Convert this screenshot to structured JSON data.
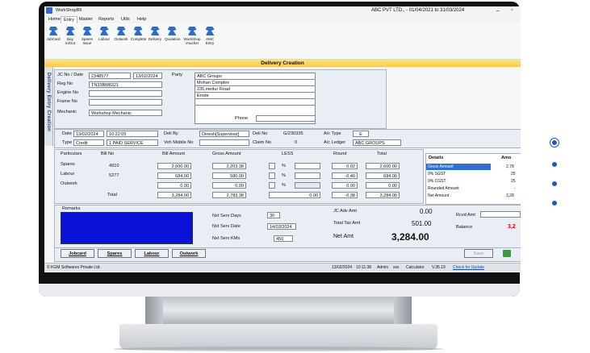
{
  "app": {
    "title": "WorkShopB9",
    "company": "ABC PVT LTD., - 01/04/2021 to 31/03/2024",
    "minimize": "–",
    "restore": "▫"
  },
  "menu": [
    "Home",
    "Entry",
    "Master",
    "Reports",
    "Utils",
    "Help"
  ],
  "ribbon": [
    {
      "label": "JobCard"
    },
    {
      "label": "Bay In/Out"
    },
    {
      "label": "Spares Issue"
    },
    {
      "label": "Labour"
    },
    {
      "label": "Outwork"
    },
    {
      "label": "Complete"
    },
    {
      "label": "Delivery"
    },
    {
      "label": "Quotation"
    },
    {
      "label": "WorkShop Voucher"
    },
    {
      "label": "AMC Entry"
    }
  ],
  "window_title": "Delivery Creation",
  "side_label": "Delivery Entry Creation",
  "jc": {
    "jc_no_label": "JC No / Date",
    "jc_no": "2348577",
    "jc_date": "13/02/2024",
    "reg_label": "Reg No",
    "reg": "TN33BM8321",
    "engine_label": "Engine No",
    "engine": "",
    "frame_label": "Frame No",
    "frame": "",
    "mechanic_label": "Mechanic",
    "mechanic": "Workshop Mechanic",
    "party_label": "Party",
    "party_lines": [
      "ABC Groups",
      "Mohan Complex",
      "235,mettur Road",
      "Erode",
      ""
    ],
    "phone_label": "Phone",
    "phone": ""
  },
  "delivery": {
    "date_label": "Date",
    "date": "13/02/2024",
    "time": "10:22:05",
    "deli_by_label": "Deli By",
    "deli_by": "Dinesh[Supervisor]",
    "deli_no_label": "Deli No",
    "deli_no": "G/230335",
    "ac_type_label": "A/c Type",
    "ac_type": "E",
    "type_label": "Type",
    "type": "Credit",
    "service": "1 PAID SERVICE",
    "veh_mobile_label": "Veh Mobile No",
    "veh_mobile": "",
    "claim_label": "Claim No",
    "claim": "0",
    "ac_ledger_label": "A/c Ledger",
    "ac_ledger": "ABC GROUPS"
  },
  "bill": {
    "headers": [
      "Particulars",
      "Bill No",
      "Bill Amount",
      "Gross Amount",
      "LESS",
      "Round",
      "Total"
    ],
    "rows": [
      {
        "particular": "Spares",
        "bill_no": "4910",
        "bill_amount": "2,600.00",
        "gross": "2,203.38",
        "pct": "%",
        "less": "",
        "round": "0.02",
        "total": "2,600.00"
      },
      {
        "particular": "Labour",
        "bill_no": "5277",
        "bill_amount": "684.00",
        "gross": "580.00",
        "pct": "%",
        "less": "",
        "round": "-0.40",
        "total": "684.00"
      },
      {
        "particular": "Outwork",
        "bill_no": "",
        "bill_amount": "0.00",
        "gross": "0.00",
        "pct": "%",
        "less": "",
        "round": "0.00",
        "total": "0.00"
      }
    ],
    "total_label": "Total",
    "total_bill": "3,284.00",
    "total_gross": "2,783.38",
    "total_less": "0.00",
    "total_round": "-0.38",
    "total_total": "3,284.00"
  },
  "details": {
    "header": "Details",
    "header2": "Amo",
    "rows": [
      {
        "label": "Gross Amount",
        "value": "2,78"
      },
      {
        "label": "9% SGST",
        "value": "25"
      },
      {
        "label": "9% CGST",
        "value": "25"
      },
      {
        "label": "Rounded Amount",
        "value": "-"
      },
      {
        "label": "Net Amount",
        "value": "3,28"
      }
    ]
  },
  "remarks": {
    "label": "Remarks",
    "value": ""
  },
  "service": {
    "nxt_days_label": "Nxt Serv Days",
    "nxt_days": "30",
    "nxt_date_label": "Nxt Serv Date",
    "nxt_date": "14/03/2024",
    "nxt_kms_label": "Nxt Serv KMs",
    "nxt_kms": "450"
  },
  "summary": {
    "jc_adv_label": "JC Adv Amt",
    "jc_adv": "0.00",
    "total_tax_label": "Total Tax Amt",
    "total_tax": "501.00",
    "net_label": "Net Amt",
    "net": "3,284.00",
    "rcvd_label": "Rcvd Amt",
    "rcvd": "",
    "balance_label": "Balance",
    "balance": "3,2"
  },
  "buttons": {
    "jobcard": "Jobcard",
    "spares": "Spares",
    "labour": "Labour",
    "outwork": "Outwork",
    "save": "Save"
  },
  "status": [
    "© KGM Softwares Private Ltd.",
    "13/02/2024",
    "10:11:38",
    "Admin",
    "sss",
    "Calculator",
    "V.35.19",
    "Check for Update"
  ],
  "colors": {
    "accent": "#1e5bb8",
    "banner": "#ffc84a",
    "remarks_bg": "#0a12d6",
    "balance": "#cc0000"
  }
}
